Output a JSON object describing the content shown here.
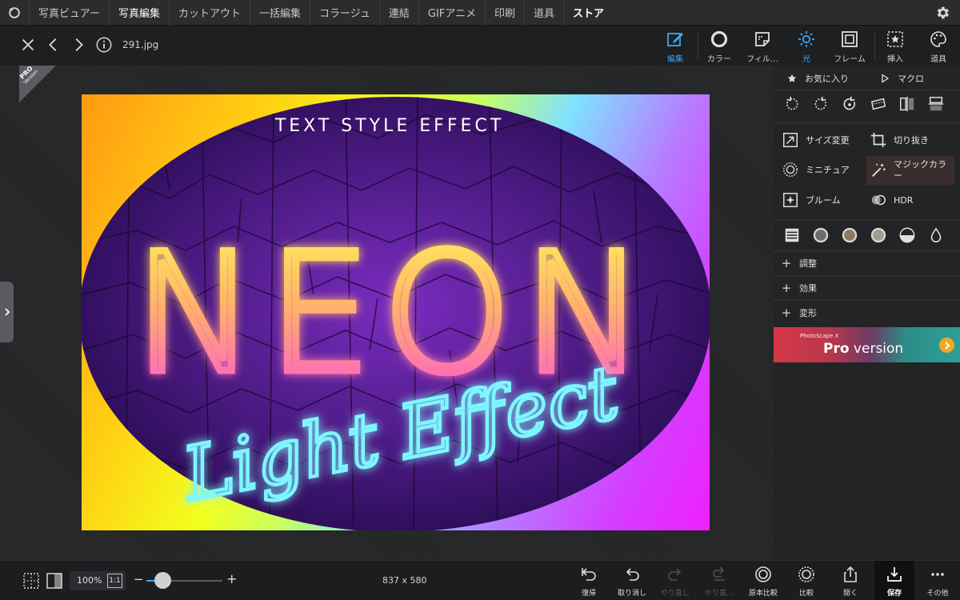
{
  "menu": {
    "tabs": [
      "写真ビュアー",
      "写真編集",
      "カットアウト",
      "一括編集",
      "コラージュ",
      "連結",
      "GIFアニメ",
      "印刷",
      "道具",
      "ストア"
    ],
    "active_index": 1
  },
  "toolbar": {
    "filename": "291.jpg",
    "tools": [
      {
        "label": "編集",
        "icon": "edit-icon",
        "active": true
      },
      {
        "label": "カラー",
        "icon": "color-icon",
        "active": false
      },
      {
        "label": "フィル…",
        "icon": "filter-icon",
        "active": false
      },
      {
        "label": "光",
        "icon": "light-icon",
        "active": true
      },
      {
        "label": "フレーム",
        "icon": "frame-icon",
        "active": false
      },
      {
        "label": "挿入",
        "icon": "insert-icon",
        "active": false
      },
      {
        "label": "道具",
        "icon": "tools-icon",
        "active": false
      }
    ],
    "accent": "#3aa7f5"
  },
  "canvas": {
    "pro_label": "PRO",
    "pro_sub": "Version",
    "image": {
      "top_text": "TEXT STYLE EFFECT",
      "title": "NEON",
      "script": "Light Effect"
    }
  },
  "right_panel": {
    "favorites": "お気に入り",
    "macro": "マクロ",
    "items": {
      "resize": "サイズ変更",
      "crop": "切り抜き",
      "miniature": "ミニチュア",
      "magic_color": "マジックカラー",
      "bloom": "ブルーム",
      "hdr": "HDR"
    },
    "sections": [
      "調整",
      "効果",
      "変形"
    ],
    "banner": {
      "small": "PhotoScape X",
      "big_bold": "Pro",
      "big_rest": " version"
    }
  },
  "bottom": {
    "zoom": "100%",
    "zoom_one": "1:1",
    "zoom_level": 0.22,
    "dimensions": "837 x 580",
    "actions": [
      {
        "label": "復帰",
        "disabled": false
      },
      {
        "label": "取り消し",
        "disabled": false
      },
      {
        "label": "やり直し",
        "disabled": true
      },
      {
        "label": "やり直…",
        "disabled": true
      },
      {
        "label": "原本比較",
        "disabled": false
      },
      {
        "label": "比較",
        "disabled": false
      },
      {
        "label": "開く",
        "disabled": false
      },
      {
        "label": "保存",
        "disabled": false
      },
      {
        "label": "その他",
        "disabled": false
      }
    ]
  }
}
